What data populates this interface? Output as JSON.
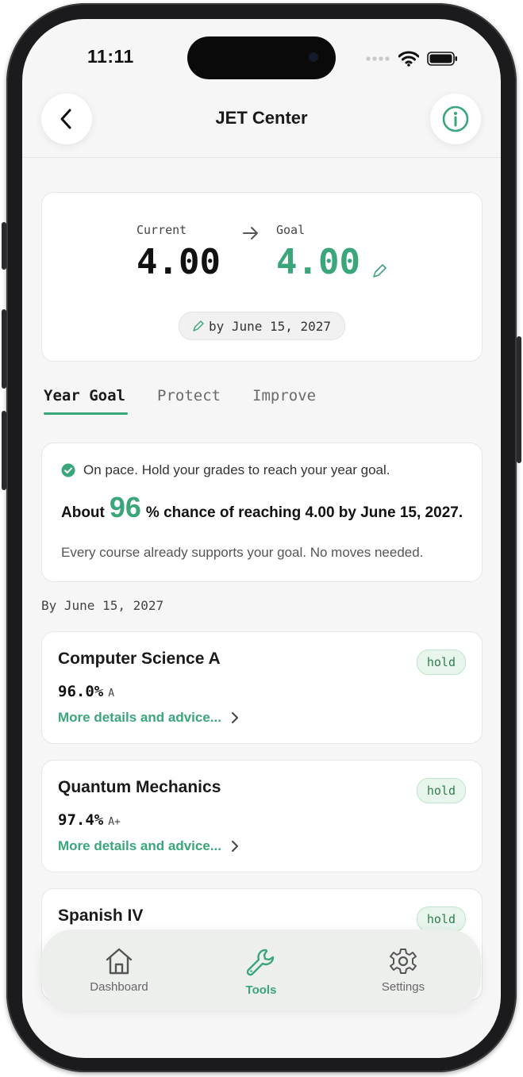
{
  "status_bar": {
    "time": "11:11"
  },
  "header": {
    "title": "JET Center"
  },
  "gpa_card": {
    "current_label": "Current",
    "current_value": "4.00",
    "goal_label": "Goal",
    "goal_value": "4.00",
    "date_pill": "by June 15, 2027"
  },
  "tabs": [
    {
      "label": "Year Goal",
      "active": true
    },
    {
      "label": "Protect",
      "active": false
    },
    {
      "label": "Improve",
      "active": false
    }
  ],
  "summary_card": {
    "status_text": "On pace. Hold your grades to reach your year goal.",
    "chance_prefix": "About",
    "chance_value": "96",
    "chance_suffix": "% chance of reaching 4.00 by June 15, 2027.",
    "note": "Every course already supports your goal. No moves needed."
  },
  "section_label": "By June 15, 2027",
  "courses": [
    {
      "name": "Computer Science A",
      "badge": "hold",
      "percent": "96.0%",
      "letter": "A",
      "details": "More details and advice..."
    },
    {
      "name": "Quantum Mechanics",
      "badge": "hold",
      "percent": "97.4%",
      "letter": "A+",
      "details": "More details and advice..."
    },
    {
      "name": "Spanish IV",
      "badge": "hold"
    }
  ],
  "tab_bar": {
    "items": [
      {
        "label": "Dashboard",
        "icon": "home-icon"
      },
      {
        "label": "Tools",
        "icon": "wrench-icon"
      },
      {
        "label": "Settings",
        "icon": "gear-icon"
      }
    ]
  },
  "colors": {
    "accent": "#3aa67a",
    "badge_bg": "#e7f5ec",
    "badge_text": "#2f7d4f",
    "screen_bg": "#f6f6f6"
  }
}
